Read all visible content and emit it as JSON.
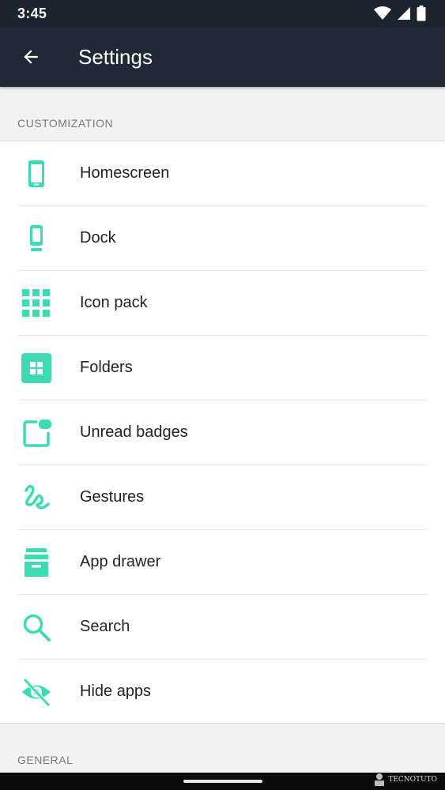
{
  "status_bar": {
    "time": "3:45"
  },
  "app_bar": {
    "title": "Settings"
  },
  "sections": [
    {
      "header": "CUSTOMIZATION"
    },
    {
      "header": "GENERAL"
    }
  ],
  "items": [
    {
      "label": "Homescreen",
      "icon": "phone-icon"
    },
    {
      "label": "Dock",
      "icon": "phone-dock-icon"
    },
    {
      "label": "Icon pack",
      "icon": "grid-icon"
    },
    {
      "label": "Folders",
      "icon": "folder-grid-icon"
    },
    {
      "label": "Unread badges",
      "icon": "badge-icon"
    },
    {
      "label": "Gestures",
      "icon": "gesture-icon"
    },
    {
      "label": "App drawer",
      "icon": "drawer-icon"
    },
    {
      "label": "Search",
      "icon": "search-icon"
    },
    {
      "label": "Hide apps",
      "icon": "eye-off-icon"
    }
  ],
  "watermark": "TECNOTUTO",
  "colors": {
    "accent": "#3ddbb4",
    "appbar": "#1f2a36",
    "statusbar": "#1b242f"
  }
}
